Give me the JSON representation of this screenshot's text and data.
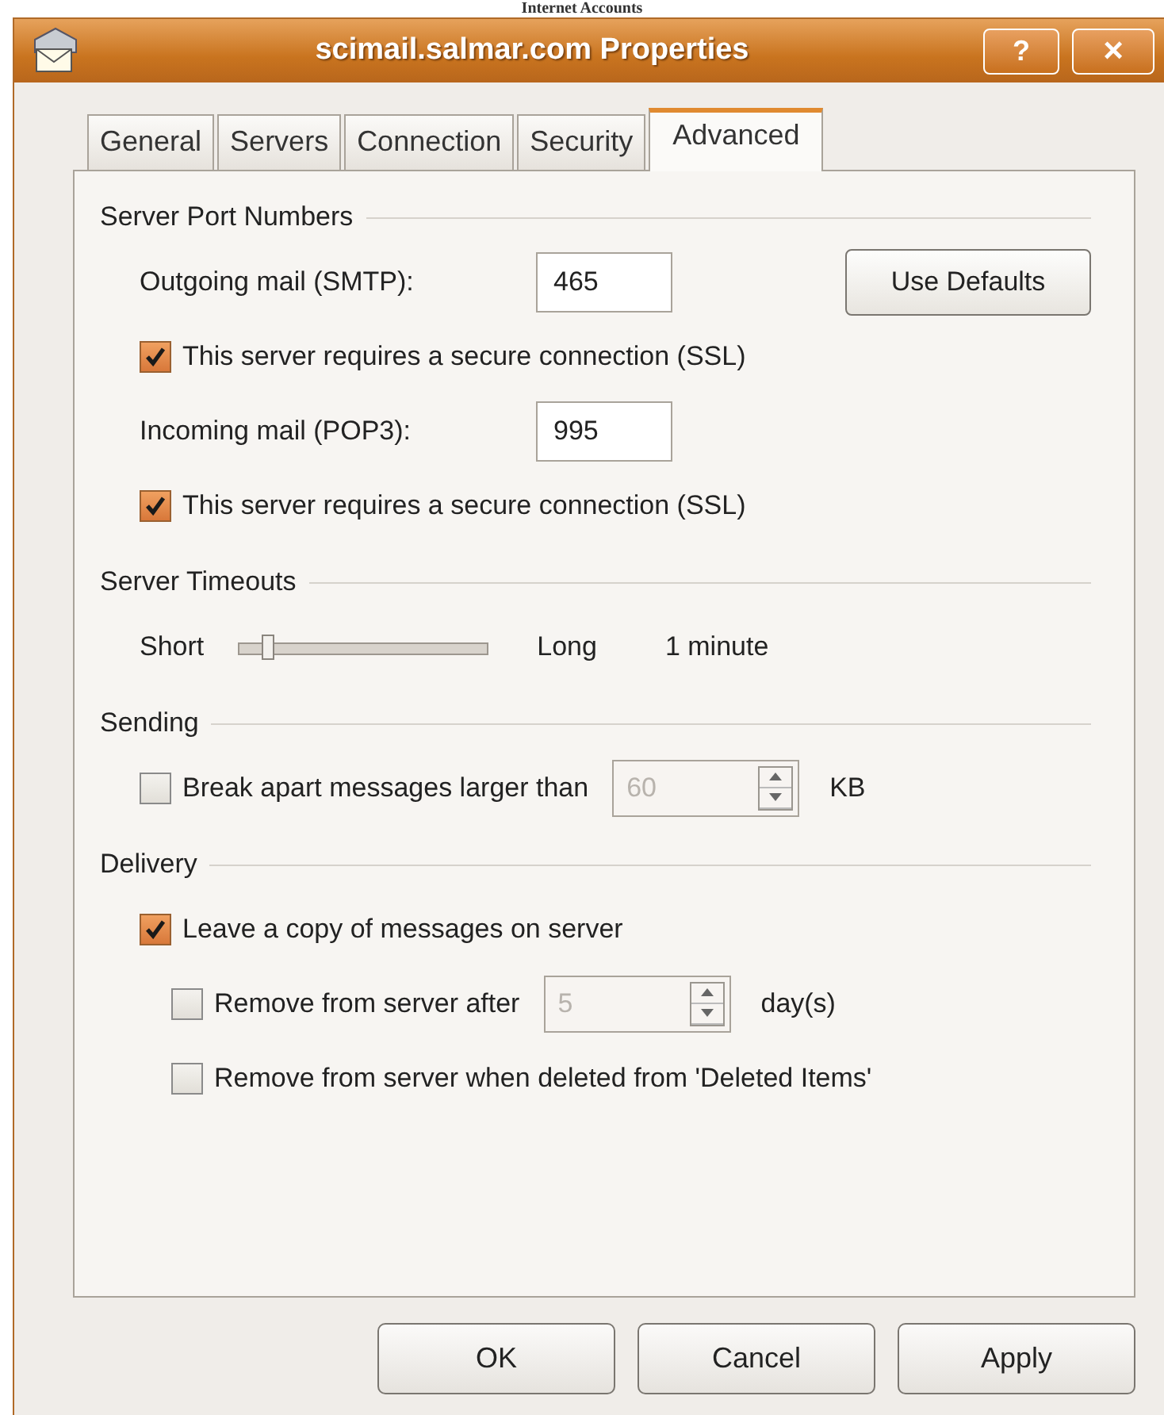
{
  "background_window": {
    "title": "Internet Accounts"
  },
  "window": {
    "title": "scimail.salmar.com Properties",
    "buttons": [
      {
        "kind": "help",
        "label": "?"
      },
      {
        "kind": "close",
        "label": "×"
      }
    ]
  },
  "tabs": [
    {
      "label": "General",
      "selected": false
    },
    {
      "label": "Servers",
      "selected": false
    },
    {
      "label": "Connection",
      "selected": false
    },
    {
      "label": "Security",
      "selected": false
    },
    {
      "label": "Advanced",
      "selected": true
    }
  ],
  "groups": [
    {
      "title": "Server Port Numbers",
      "rows": [
        {
          "kind": "port",
          "label": "Outgoing mail (SMTP):",
          "value": "465",
          "button": "Use Defaults"
        },
        {
          "kind": "check",
          "label": "This server requires a secure connection (SSL)",
          "checked": true
        },
        {
          "kind": "port",
          "label": "Incoming mail (POP3):",
          "value": "995"
        },
        {
          "kind": "check",
          "label": "This server requires a secure connection (SSL)",
          "checked": true
        }
      ]
    },
    {
      "title": "Server Timeouts",
      "rows": [
        {
          "kind": "slider",
          "min_label": "Short",
          "max_label": "Long",
          "level": 0.12,
          "reading": "1 minute"
        }
      ]
    },
    {
      "title": "Sending",
      "rows": [
        {
          "kind": "check_spin",
          "label": "Break apart messages larger than",
          "checked": false,
          "value": "60",
          "disabled": true,
          "unit": "KB"
        }
      ]
    },
    {
      "title": "Delivery",
      "rows": [
        {
          "kind": "check",
          "label": "Leave a copy of messages on server",
          "checked": true,
          "children": [
            {
              "kind": "check_spin",
              "label": "Remove from server after",
              "checked": false,
              "value": "5",
              "disabled": true,
              "unit": "day(s)"
            },
            {
              "kind": "check",
              "label": "Remove from server when deleted from 'Deleted Items'",
              "checked": false
            }
          ]
        }
      ]
    }
  ],
  "buttons": [
    "OK",
    "Cancel",
    "Apply"
  ]
}
